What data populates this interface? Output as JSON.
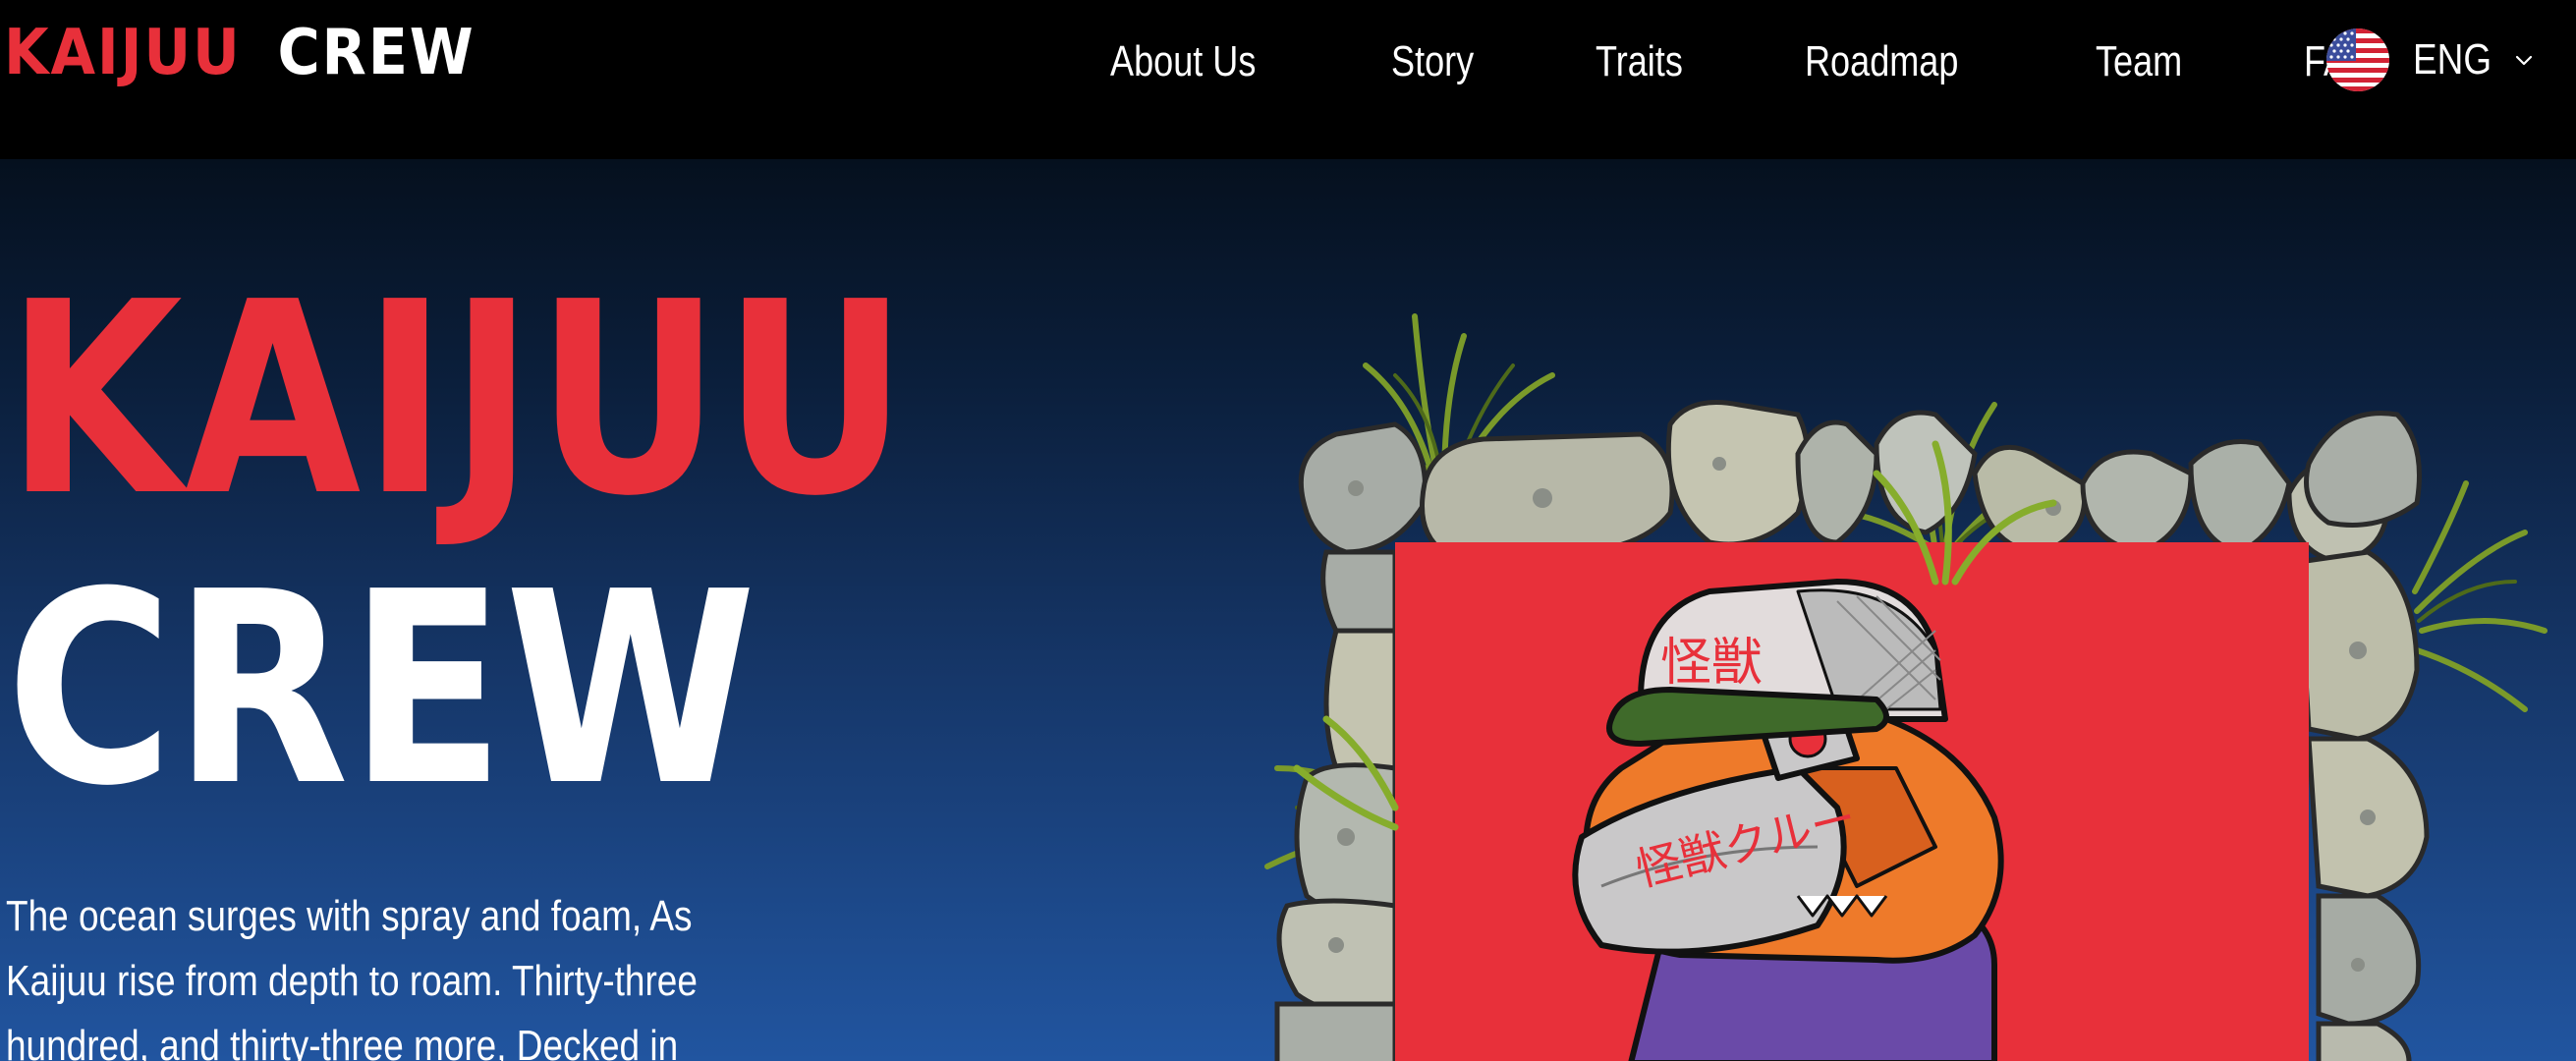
{
  "nav": {
    "logo": {
      "part1": "KAIJUU",
      "part2": "CREW"
    },
    "links": [
      "About Us",
      "Story",
      "Traits",
      "Roadmap",
      "Team",
      "FAQ"
    ],
    "language": {
      "label": "ENG",
      "flag_icon": "us-flag-icon",
      "chevron_icon": "chevron-down-icon"
    }
  },
  "hero": {
    "title_line1": "KAIJUU",
    "title_line2": "CREW",
    "text": "The ocean surges with spray and foam, As Kaijuu rise from depth to roam. Thirty-three hundred, and thirty-three more, Decked in"
  },
  "artwork": {
    "hat_text": "怪獣",
    "mask_text": "怪獣クルー",
    "description_icon": "kaijuu-character-artwork"
  },
  "colors": {
    "brand_red": "#e8303a",
    "nav_bg": "#000000",
    "hero_top": "#05101e",
    "hero_bottom": "#2155a0",
    "text_white": "#ffffff"
  }
}
